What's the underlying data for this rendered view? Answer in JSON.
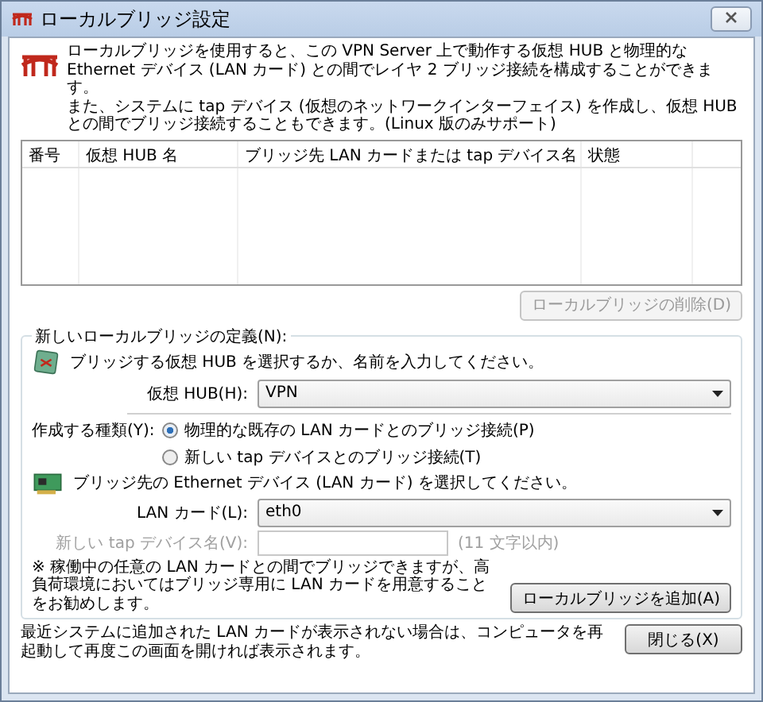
{
  "window": {
    "title": "ローカルブリッジ設定"
  },
  "intro": [
    "ローカルブリッジを使用すると、この VPN Server 上で動作する仮想 HUB と物理的な Ethernet デバイス (LAN カード) との間でレイヤ 2 ブリッジ接続を構成することができます。",
    "また、システムに tap デバイス (仮想のネットワークインターフェイス) を作成し、仮想 HUB との間でブリッジ接続することもできます。(Linux 版のみサポート)"
  ],
  "table": {
    "columns": [
      "番号",
      "仮想 HUB 名",
      "ブリッジ先 LAN カードまたは tap デバイス名",
      "状態"
    ]
  },
  "delete_button": {
    "label": "ローカルブリッジの削除(D)",
    "disabled": true
  },
  "group": {
    "title": "新しいローカルブリッジの定義(N):",
    "hub_hint": "ブリッジする仮想 HUB を選択するか、名前を入力してください。",
    "hub_label": "仮想 HUB(H):",
    "hub_value": "VPN",
    "type_label": "作成する種類(Y):",
    "types": [
      {
        "label": "物理的な既存の LAN カードとのブリッジ接続(P)",
        "selected": true
      },
      {
        "label": "新しい tap デバイスとのブリッジ接続(T)",
        "selected": false
      }
    ],
    "lan_hint": "ブリッジ先の Ethernet デバイス (LAN カード) を選択してください。",
    "lan_label": "LAN カード(L):",
    "lan_value": "eth0",
    "tap_label": "新しい tap デバイス名(V):",
    "tap_disabled": true,
    "tap_note": "(11 文字以内)",
    "note": "※ 稼働中の任意の LAN カードとの間でブリッジできますが、高負荷環境においてはブリッジ専用に LAN カードを用意することをお勧めします。",
    "add_button": "ローカルブリッジを追加(A)"
  },
  "footer": {
    "text": "最近システムに追加された LAN カードが表示されない場合は、コンピュータを再起動して再度この画面を開ければ表示されます。",
    "close_button": "閉じる(X)"
  }
}
